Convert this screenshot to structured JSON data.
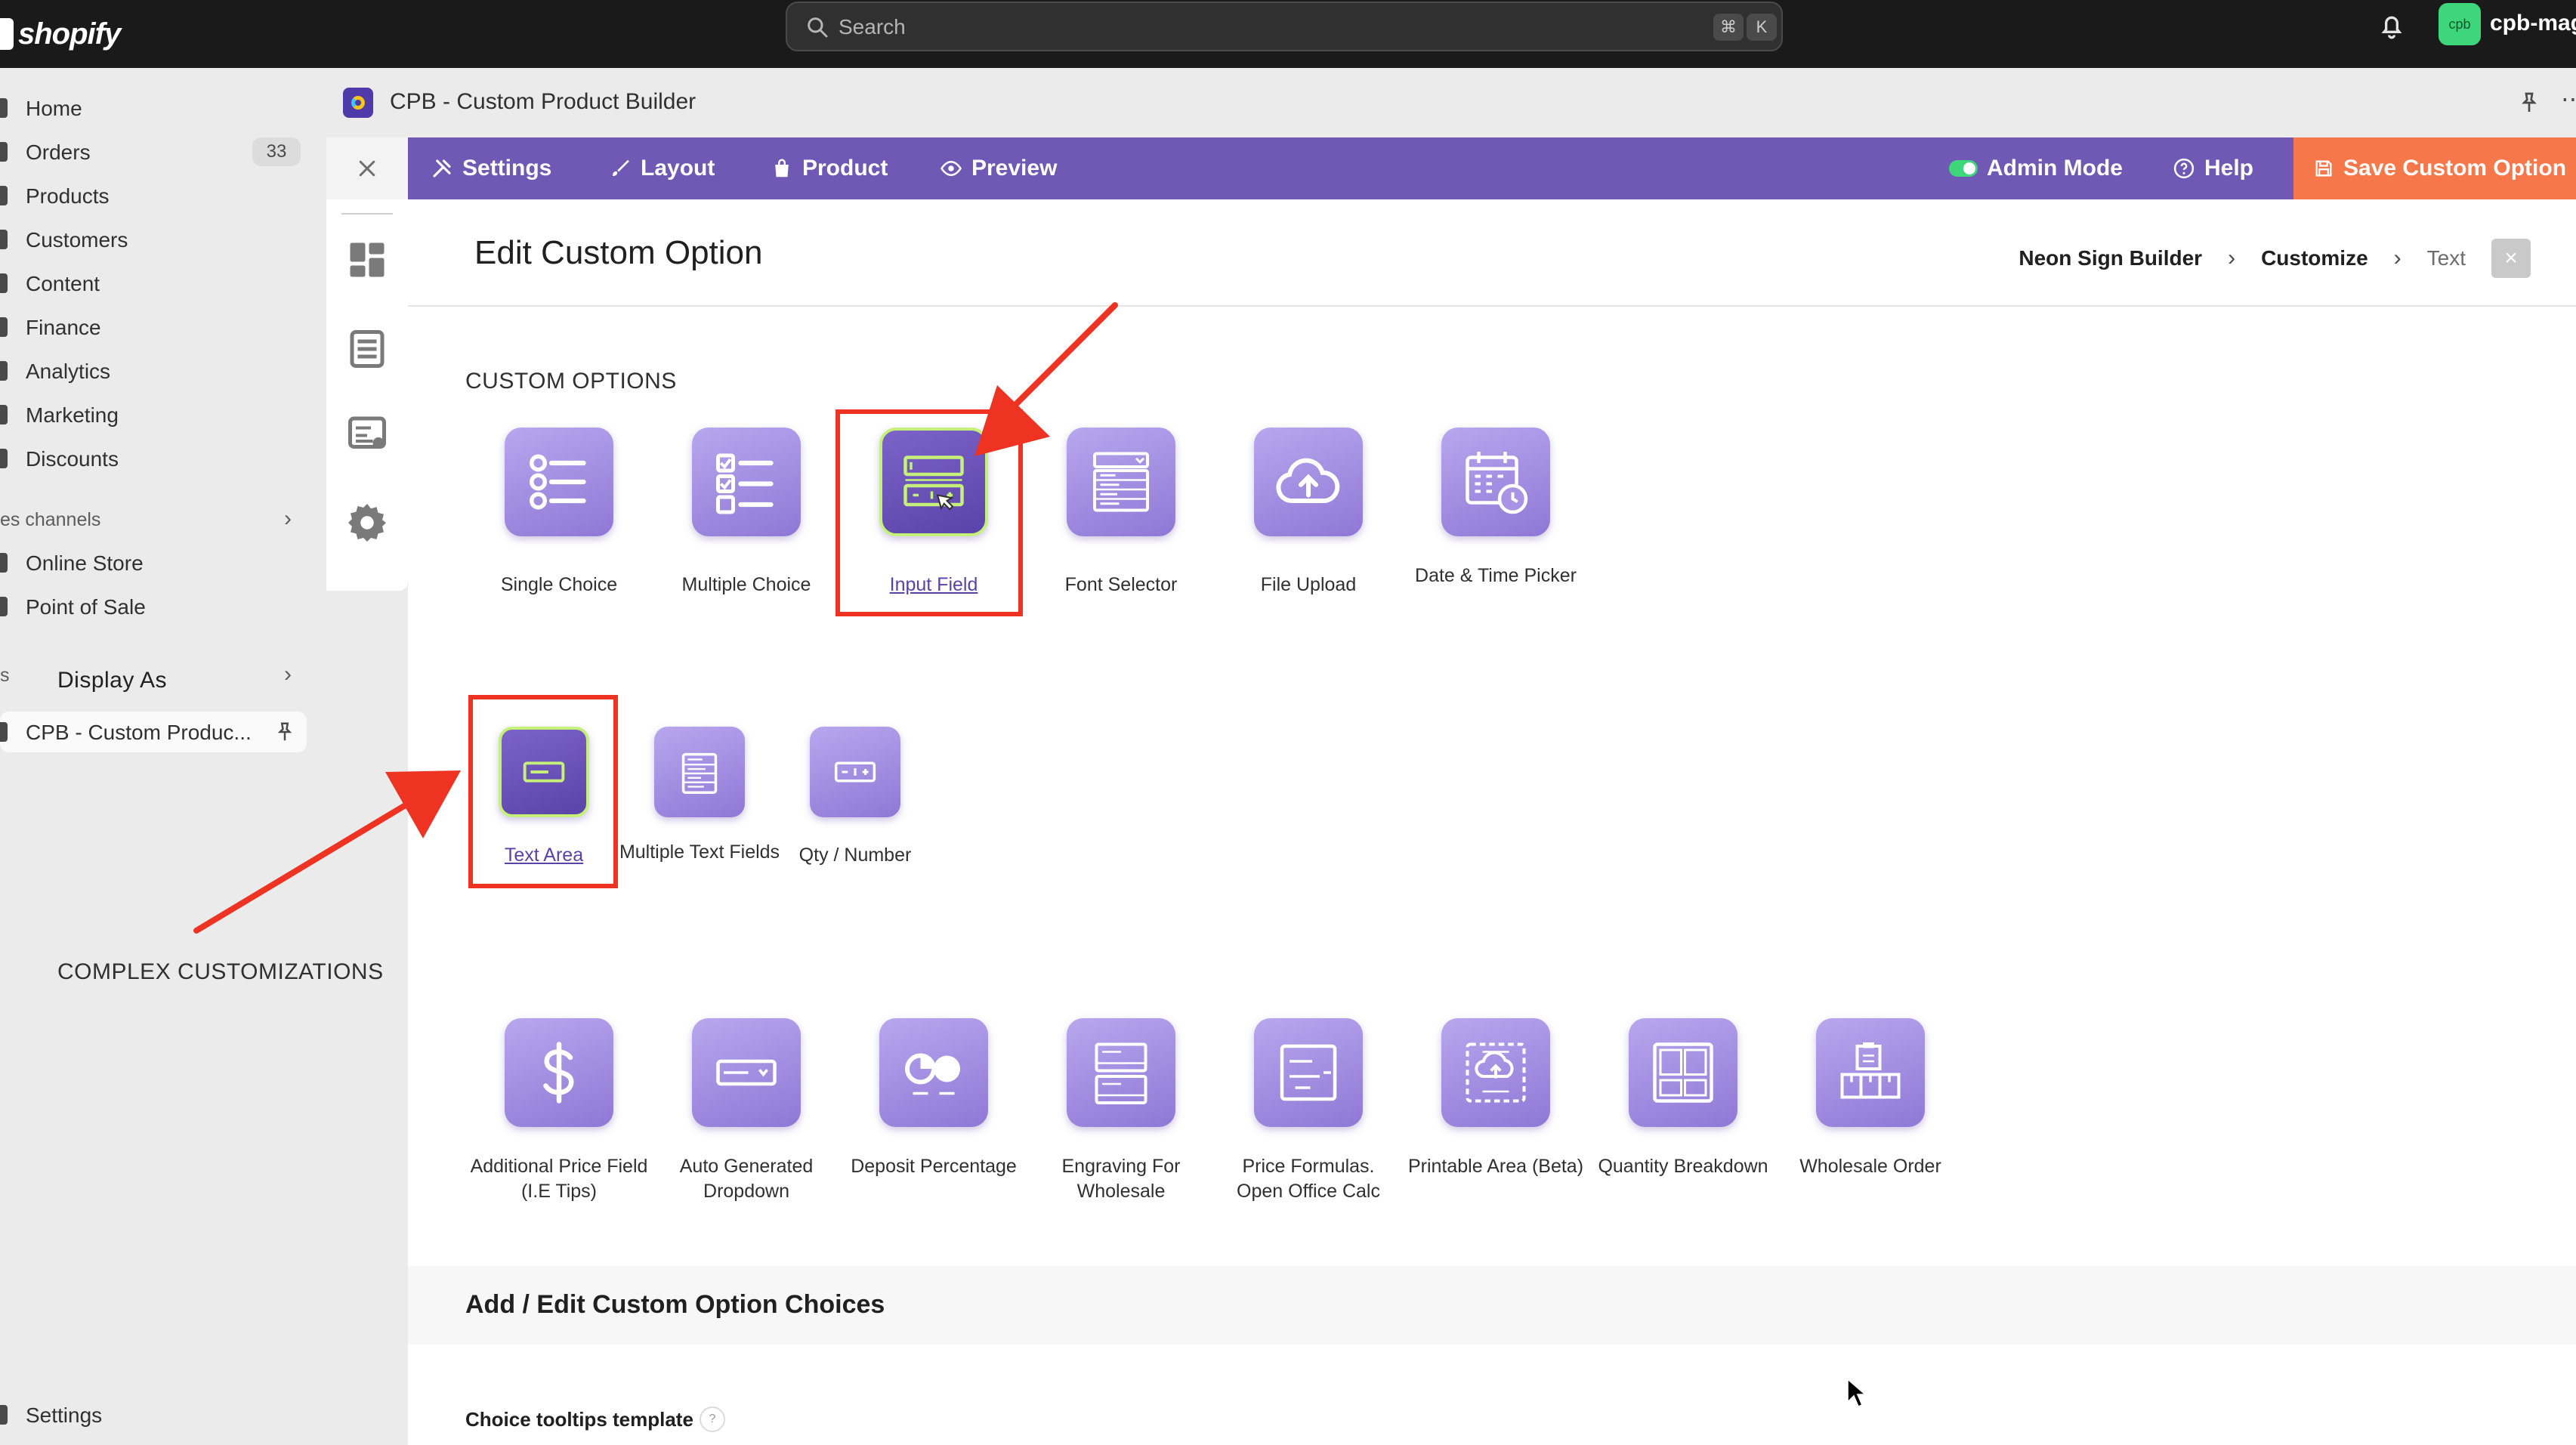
{
  "topbar": {
    "brand": "shopify",
    "search_placeholder": "Search",
    "shortcut_keys": [
      "⌘",
      "K"
    ],
    "account_avatar": "cpb",
    "account_name": "cpb-mago"
  },
  "sidebar": {
    "items": [
      {
        "label": "Home"
      },
      {
        "label": "Orders",
        "badge": "33"
      },
      {
        "label": "Products"
      },
      {
        "label": "Customers"
      },
      {
        "label": "Content"
      },
      {
        "label": "Finance"
      },
      {
        "label": "Analytics"
      },
      {
        "label": "Marketing"
      },
      {
        "label": "Discounts"
      }
    ],
    "sales_channels_heading": "es channels",
    "channels": [
      {
        "label": "Online Store"
      },
      {
        "label": "Point of Sale"
      }
    ],
    "apps_heading": "s",
    "app_item": "CPB - Custom Produc...",
    "settings_label": "Settings"
  },
  "app": {
    "title": "CPB - Custom Product Builder",
    "toolbar": {
      "settings": "Settings",
      "layout": "Layout",
      "product": "Product",
      "preview": "Preview",
      "admin_mode": "Admin Mode",
      "help": "Help",
      "save": "Save Custom Option"
    }
  },
  "page": {
    "title": "Edit Custom Option",
    "breadcrumb": [
      "Neon Sign Builder",
      "Customize",
      "Text"
    ],
    "custom_options_heading": "CUSTOM OPTIONS",
    "custom_options": [
      {
        "label": "Single Choice",
        "icon": "radio-list-icon"
      },
      {
        "label": "Multiple Choice",
        "icon": "checkbox-list-icon"
      },
      {
        "label": "Input Field",
        "icon": "input-field-icon",
        "selected": true
      },
      {
        "label": "Font Selector",
        "icon": "font-selector-icon"
      },
      {
        "label": "File Upload",
        "icon": "cloud-upload-icon"
      },
      {
        "label": "Date & Time Picker",
        "icon": "calendar-clock-icon"
      }
    ],
    "display_as_heading": "Display As",
    "display_as": [
      {
        "label": "Text Area",
        "icon": "one-line-icon",
        "selected": true
      },
      {
        "label": "Multiple Text Fields",
        "icon": "multiple-lines-icon"
      },
      {
        "label": "Qty / Number",
        "icon": "qty-stepper-icon"
      }
    ],
    "complex_heading": "COMPLEX CUSTOMIZATIONS",
    "complex": [
      {
        "label": "Additional Price Field (I.E Tips)",
        "icon": "dollar-icon"
      },
      {
        "label": "Auto Generated Dropdown",
        "icon": "dropdown-icon"
      },
      {
        "label": "Deposit Percentage",
        "icon": "deposit-icon"
      },
      {
        "label": "Engraving For Wholesale",
        "icon": "engraving-icon"
      },
      {
        "label": "Price Formulas. Open Office Calc",
        "icon": "formula-icon"
      },
      {
        "label": "Printable Area (Beta)",
        "icon": "printable-area-icon"
      },
      {
        "label": "Quantity Breakdown",
        "icon": "quantity-breakdown-icon"
      },
      {
        "label": "Wholesale Order",
        "icon": "wholesale-icon"
      }
    ],
    "choices_heading": "Add / Edit Custom Option Choices",
    "tooltips_label": "Choice tooltips template",
    "help_mark": "?"
  },
  "colors": {
    "toolbar": "#6f59b5",
    "save": "#f6784a",
    "tile": "#a893e4",
    "annotation": "#ee3322"
  }
}
